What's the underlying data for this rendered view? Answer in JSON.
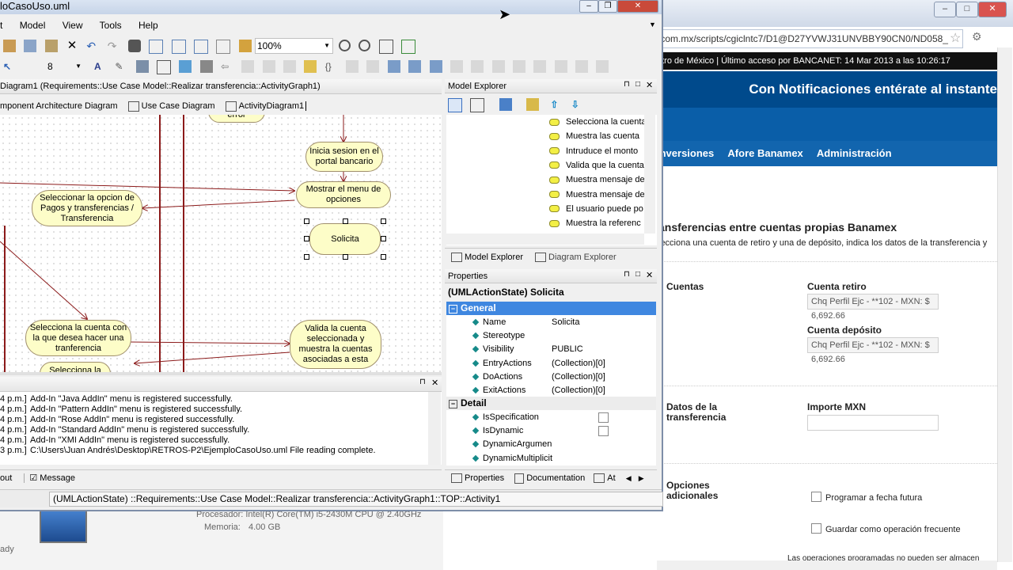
{
  "browser": {
    "address": ".com.mx/scripts/cgiclntc7/D1@D27YVWJ31UNVBBY90CN0/ND058_",
    "navbar": "ntro de México | Último acceso por BANCANET: 14 Mar 2013 a las 10:26:17",
    "banner": "Con Notificaciones entérate al instante",
    "menu": [
      "Inversiones",
      "Afore Banamex",
      "Administración"
    ],
    "heading": "ansferencias entre cuentas propias Banamex",
    "subheading": "lecciona una cuenta de retiro y una de depósito, indica los datos de la transferencia y",
    "cuentas_label": "Cuentas",
    "cuenta_retiro_label": "Cuenta retiro",
    "cuenta_retiro_value": "Chq Perfil Ejc  -  **102  -  MXN: $ 6,692.66",
    "cuenta_deposito_label": "Cuenta depósito",
    "cuenta_deposito_value": "Chq Perfil Ejc  -  **102  -  MXN: $ 6,692.66",
    "datos_label_1": "Datos de la",
    "datos_label_2": "transferencia",
    "importe_label": "Importe  MXN",
    "opciones_label_1": "Opciones",
    "opciones_label_2": "adicionales",
    "programar": "Programar a fecha futura",
    "guardar": "Guardar como operación frecuente",
    "footer_note": "Las operaciones programadas no pueden ser almacen"
  },
  "sysinfo": {
    "procesador": "Procesador:  Intel(R) Core(TM) i5-2430M CPU @ 2.40GHz",
    "memoria_label": "Memoria:",
    "memoria_value": "4.00 GB",
    "ready": "ady"
  },
  "app": {
    "title": "loCasoUso.uml",
    "menu": [
      "t",
      "Model",
      "View",
      "Tools",
      "Help"
    ],
    "zoom": "100%",
    "font_size": "8",
    "diagram_title": "Diagram1 (Requirements::Use Case Model::Realizar transferencia::ActivityGraph1)",
    "tabs": [
      "mponent Architecture Diagram",
      "Use Case Diagram",
      "ActivityDiagram1"
    ],
    "nodes": {
      "error": "error",
      "inicia": "Inicia sesion en el portal bancario",
      "seleccionar": "Seleccionar la opcion de Pagos y transferencias / Transferencia",
      "mostrar": "Mostrar el menu de opciones",
      "solicita": "Solicita",
      "selecciona_cuenta": "Selecciona la cuenta con la que desea hacer una tranferencia",
      "valida": "Valida la cuenta seleccionada y muestra la cuentas asociadas a esta",
      "selecciona_la": "Selecciona la"
    },
    "output_lines": [
      {
        "time": "4 p.m.]",
        "msg": "Add-In \"Java AddIn\" menu is registered successfully."
      },
      {
        "time": "4 p.m.]",
        "msg": "Add-In \"Pattern AddIn\" menu is registered successfully."
      },
      {
        "time": "4 p.m.]",
        "msg": "Add-In \"Rose AddIn\" menu is registered successfully."
      },
      {
        "time": "4 p.m.]",
        "msg": "Add-In \"Standard AddIn\" menu is registered successfully."
      },
      {
        "time": "4 p.m.]",
        "msg": "Add-In \"XMI AddIn\" menu is registered successfully."
      },
      {
        "time": "3 p.m.]",
        "msg": "C:\\Users\\Juan Andrés\\Desktop\\RETROS-P2\\EjemploCasoUso.uml File reading complete."
      }
    ],
    "output_tabs": [
      "out",
      "Message"
    ],
    "status_bar": "(UMLActionState) ::Requirements::Use Case Model::Realizar transferencia::ActivityGraph1::TOP::Activity1"
  },
  "model_explorer": {
    "title": "Model Explorer",
    "items": [
      "Selecciona la cuenta",
      "Muestra las cuenta",
      "Intruduce el monto",
      "Valida que la cuenta",
      "Muestra mensaje de",
      "Muestra mensaje de",
      "El usuario puede po",
      "Muestra la referenc"
    ],
    "tabs": [
      "Model Explorer",
      "Diagram Explorer"
    ]
  },
  "properties": {
    "title": "Properties",
    "object": "(UMLActionState) Solicita",
    "general_label": "General",
    "general": [
      {
        "name": "Name",
        "value": "Solicita"
      },
      {
        "name": "Stereotype",
        "value": ""
      },
      {
        "name": "Visibility",
        "value": "PUBLIC"
      },
      {
        "name": "EntryActions",
        "value": "(Collection)[0]"
      },
      {
        "name": "DoActions",
        "value": "(Collection)[0]"
      },
      {
        "name": "ExitActions",
        "value": "(Collection)[0]"
      }
    ],
    "detail_label": "Detail",
    "detail": [
      {
        "name": "IsSpecification",
        "value": ""
      },
      {
        "name": "IsDynamic",
        "value": ""
      },
      {
        "name": "DynamicArgumen",
        "value": ""
      },
      {
        "name": "DynamicMultiplicit",
        "value": ""
      }
    ],
    "tabs": [
      "Properties",
      "Documentation",
      "At"
    ]
  }
}
